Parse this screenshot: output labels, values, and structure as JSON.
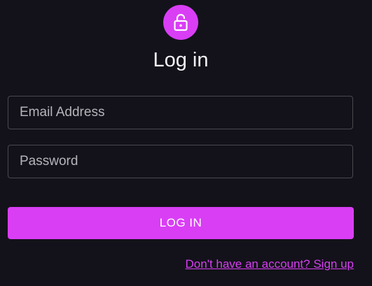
{
  "header": {
    "icon": "lock-open-icon",
    "title": "Log in"
  },
  "form": {
    "email_placeholder": "Email Address",
    "password_placeholder": "Password",
    "submit_label": "LOG IN"
  },
  "footer": {
    "signup_link": "Don't have an account? Sign up"
  },
  "colors": {
    "background": "#13121a",
    "accent": "#d93ef5",
    "field_border": "#4a4950",
    "text": "#f2f1f5"
  }
}
